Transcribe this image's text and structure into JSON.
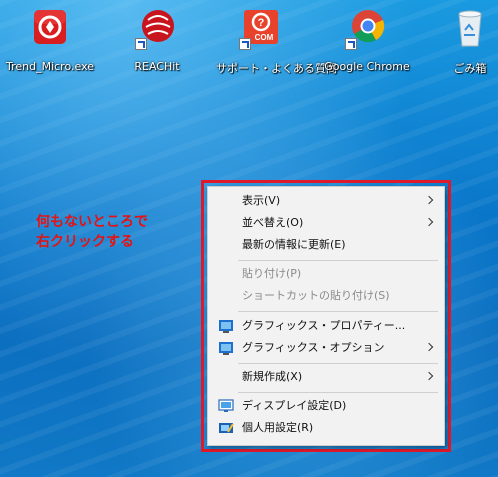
{
  "desktop_icons": [
    {
      "label": "Trend_Micro.exe",
      "icon": "trend-micro-icon"
    },
    {
      "label": "REACHit",
      "icon": "reachit-icon"
    },
    {
      "label": "サポート・よくある質問",
      "icon": "support-faq-icon",
      "badge": "COM"
    },
    {
      "label": "Google Chrome",
      "icon": "chrome-icon"
    },
    {
      "label": "ごみ箱",
      "icon": "recycle-bin-icon"
    }
  ],
  "annotation": {
    "line1": "何もないところで",
    "line2": "右クリックする"
  },
  "context_menu": {
    "view": "表示(V)",
    "sort": "並べ替え(O)",
    "refresh": "最新の情報に更新(E)",
    "paste": "貼り付け(P)",
    "paste_shortcut": "ショートカットの貼り付け(S)",
    "graphics_properties": "グラフィックス・プロパティー...",
    "graphics_options": "グラフィックス・オプション",
    "new": "新規作成(X)",
    "display_settings": "ディスプレイ設定(D)",
    "personalize": "個人用設定(R)"
  },
  "colors": {
    "annotation_red": "#e81010",
    "frame_red": "#e0192a",
    "menu_bg": "#f2f2f2",
    "disabled_text": "#8a8a8a"
  }
}
